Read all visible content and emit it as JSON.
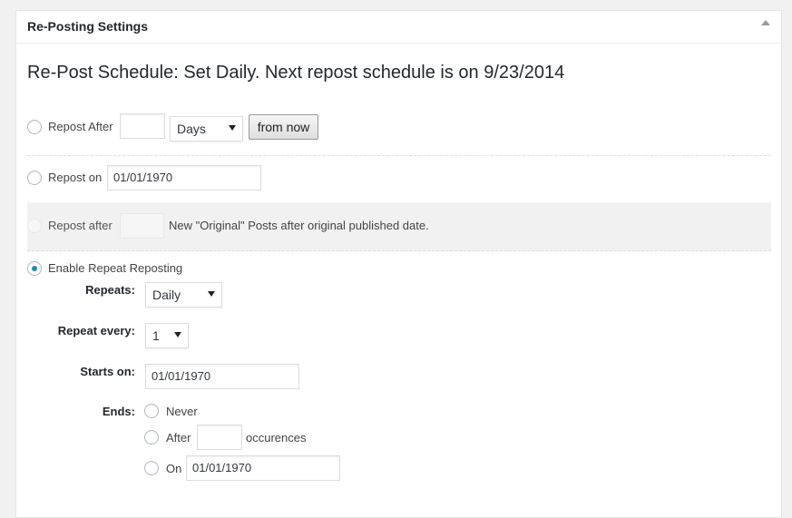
{
  "panel": {
    "title": "Re-Posting Settings"
  },
  "schedule_heading": "Re-Post Schedule: Set Daily. Next repost schedule is on 9/23/2014",
  "repost_after": {
    "label": "Repost After",
    "value": "",
    "unit": "Days",
    "button": "from now"
  },
  "repost_on": {
    "label": "Repost on",
    "date": "01/01/1970"
  },
  "repost_after_original": {
    "label": "Repost after",
    "value": "",
    "suffix": "New \"Original\" Posts after original published date."
  },
  "repeat": {
    "enable_label": "Enable Repeat Reposting",
    "repeats_label": "Repeats:",
    "repeats_value": "Daily",
    "every_label": "Repeat every:",
    "every_value": "1",
    "starts_label": "Starts on:",
    "starts_value": "01/01/1970",
    "ends_label": "Ends:",
    "ends_never": "Never",
    "ends_after": "After",
    "ends_after_value": "",
    "ends_occurrences": "occurences",
    "ends_on": "On",
    "ends_on_value": "01/01/1970"
  }
}
